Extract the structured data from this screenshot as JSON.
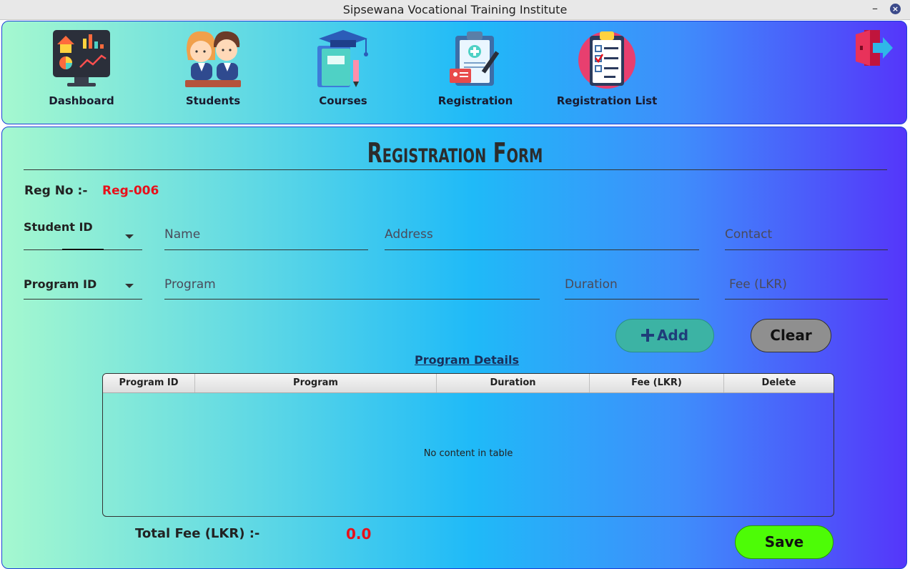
{
  "window": {
    "title": "Sipsewana Vocational Training Institute",
    "minimize_glyph": "–",
    "close_glyph": "×"
  },
  "nav": {
    "items": [
      {
        "label": "Dashboard",
        "icon": "dashboard-monitor-icon"
      },
      {
        "label": "Students",
        "icon": "students-icon"
      },
      {
        "label": "Courses",
        "icon": "courses-books-icon"
      },
      {
        "label": "Registration",
        "icon": "registration-clipboard-icon"
      },
      {
        "label": "Registration List",
        "icon": "registration-list-icon"
      }
    ],
    "logout_icon": "logout-door-icon"
  },
  "form": {
    "title": "Registration Form",
    "reg_no_label": "Reg No :-",
    "reg_no_value": "Reg-006",
    "student_id_label": "Student ID",
    "name_placeholder": "Name",
    "address_placeholder": "Address",
    "contact_placeholder": "Contact",
    "program_id_label": "Program ID",
    "program_placeholder": "Program",
    "duration_placeholder": "Duration",
    "fee_placeholder": "Fee (LKR)",
    "add_label": "Add",
    "clear_label": "Clear",
    "program_details_title": "Program Details",
    "table": {
      "columns": [
        "Program ID",
        "Program",
        "Duration",
        "Fee (LKR)",
        "Delete"
      ],
      "rows": [],
      "empty_text": "No content in table"
    },
    "total_fee_label": "Total Fee (LKR) :-",
    "total_fee_value": "0.0",
    "save_label": "Save"
  },
  "colors": {
    "accent_red": "#e8101a",
    "save_green": "#4dfc06",
    "add_teal": "#3cb3a4",
    "clear_gray": "#8f8f8f",
    "border_blue": "#1d3fd8"
  }
}
